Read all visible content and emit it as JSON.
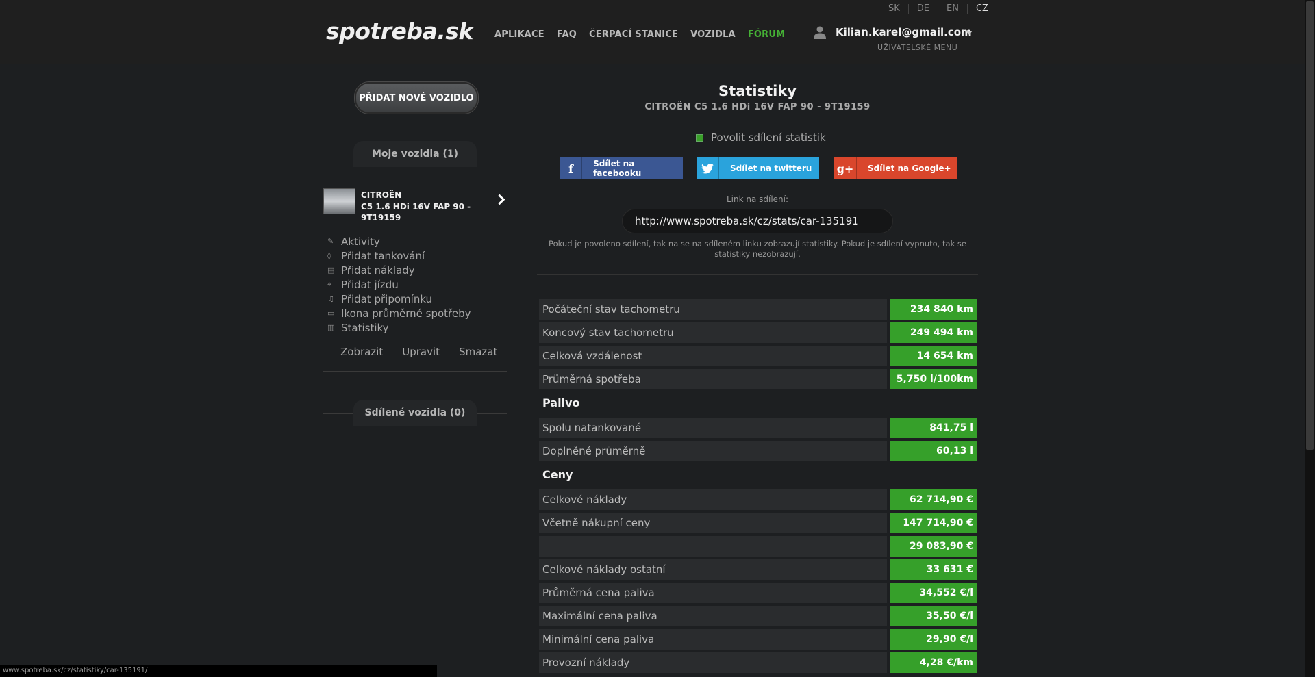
{
  "header": {
    "logo": "spotreba.sk",
    "nav": [
      "APLIKACE",
      "FAQ",
      "ČERPACÍ STANICE",
      "VOZIDLA",
      "FÓRUM"
    ],
    "languages": [
      "SK",
      "DE",
      "EN",
      "CZ"
    ],
    "active_language": "CZ",
    "user_email": "Kilian.karel@gmail.com",
    "user_menu": "UŽIVATELSKÉ MENU"
  },
  "sidebar": {
    "add_vehicle": "PŘIDAT NOVÉ VOZIDLO",
    "my_vehicles": "Moje vozidla (1)",
    "car": {
      "brand": "CITROËN",
      "model": "C5 1.6 HDi 16V FAP 90 - 9T19159"
    },
    "menu": [
      {
        "icon": "pencil-icon",
        "label": "Aktivity"
      },
      {
        "icon": "drop-icon",
        "label": "Přidat tankování"
      },
      {
        "icon": "receipt-icon",
        "label": "Přidat náklady"
      },
      {
        "icon": "pin-icon",
        "label": "Přidat jízdu"
      },
      {
        "icon": "bell-icon",
        "label": "Přidat připomínku"
      },
      {
        "icon": "badge-icon",
        "label": "Ikona průměrné spotřeby"
      },
      {
        "icon": "bar-chart-icon",
        "label": "Statistiky"
      }
    ],
    "actions": [
      "Zobrazit",
      "Upravit",
      "Smazat"
    ],
    "shared_vehicles": "Sdílené vozidla (0)"
  },
  "main": {
    "title": "Statistiky",
    "subtitle": "CITROËN C5 1.6 HDi 16V FAP 90 - 9T19159",
    "share_toggle": "Povolit sdílení statistik",
    "share_buttons": {
      "facebook": "Sdílet na facebooku",
      "twitter": "Sdílet na twitteru",
      "google": "Sdílet na Google+"
    },
    "link_label": "Link na sdílení:",
    "link_value": "http://www.spotreba.sk/cz/stats/car-135191",
    "note": "Pokud je povoleno sdílení, tak na se na sdíleném linku zobrazují statistiky. Pokud je sdílení vypnuto, tak se statistiky nezobrazují.",
    "stats": [
      {
        "label": "Počáteční stav tachometru",
        "value": "234 840 km"
      },
      {
        "label": "Koncový stav tachometru",
        "value": "249 494 km"
      },
      {
        "label": "Celková vzdálenost",
        "value": "14 654 km"
      },
      {
        "label": "Průměrná spotřeba",
        "value": "5,750 l/100km"
      }
    ],
    "fuel_heading": "Palivo",
    "fuel": [
      {
        "label": "Spolu natankované",
        "value": "841,75 l"
      },
      {
        "label": "Doplněné průměrně",
        "value": "60,13 l"
      }
    ],
    "prices_heading": "Ceny",
    "prices": [
      {
        "label": "Celkové náklady",
        "value": "62 714,90 €"
      },
      {
        "label": "Včetně nákupní ceny",
        "value": "147 714,90 €"
      },
      {
        "label": "",
        "value": "29 083,90 €"
      },
      {
        "label": "Celkové náklady ostatní",
        "value": "33 631 €"
      },
      {
        "label": "Průměrná cena paliva",
        "value": "34,552 €/l"
      },
      {
        "label": "Maximální cena paliva",
        "value": "35,50 €/l"
      },
      {
        "label": "Minimální cena paliva",
        "value": "29,90 €/l"
      },
      {
        "label": "Provozní náklady",
        "value": "4,28 €/km"
      }
    ]
  },
  "statusbar": "www.spotreba.sk/cz/statistiky/car-135191/"
}
